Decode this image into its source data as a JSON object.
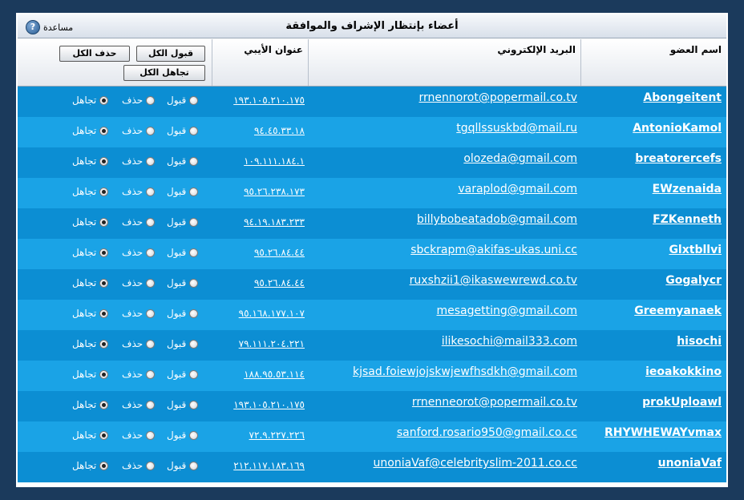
{
  "window": {
    "title": "أعضاء بإنتظار الإشراف والموافقة",
    "help_label": "مساعدة",
    "help_glyph": "?"
  },
  "columns": {
    "member": "اسم العضو",
    "email": "البريد الإلكتروني",
    "ip": "عنوان الأيبي"
  },
  "buttons": {
    "accept_all": "قبول الكل",
    "delete_all": "حذف الكل",
    "ignore_all": "تجاهل الكل"
  },
  "options": {
    "accept": "قبول",
    "delete": "حذف",
    "ignore": "تجاهل"
  },
  "rows": [
    {
      "member": "Abongeitent",
      "email": "rrnennorot@popermail.co.tv",
      "ip": "١٩٣.١٠٥.٢١٠.١٧٥",
      "selected": "ignore"
    },
    {
      "member": "AntonioKamol",
      "email": "tgqllssuskbd@mail.ru",
      "ip": "٩٤.٤٥.٣٣.١٨",
      "selected": "ignore"
    },
    {
      "member": "breatorercefs",
      "email": "olozeda@gmail.com",
      "ip": "١٠٩.١١١.١٨٤.١",
      "selected": "ignore"
    },
    {
      "member": "EWzenaida",
      "email": "varaplod@gmail.com",
      "ip": "٩٥.٢٦.٢٣٨.١٧٣",
      "selected": "ignore"
    },
    {
      "member": "FZKenneth",
      "email": "billybobeatadob@gmail.com",
      "ip": "٩٤.١٩.١٨٣.٢٣٣",
      "selected": "ignore"
    },
    {
      "member": "Glxtbllvi",
      "email": "sbckrapm@akifas-ukas.uni.cc",
      "ip": "٩٥.٢٦.٨٤.٤٤",
      "selected": "ignore"
    },
    {
      "member": "Gogalycr",
      "email": "ruxshzii1@ikaswewrewd.co.tv",
      "ip": "٩٥.٢٦.٨٤.٤٤",
      "selected": "ignore"
    },
    {
      "member": "Greemyanaek",
      "email": "mesagetting@gmail.com",
      "ip": "٩٥.١٦٨.١٧٧.١٠٧",
      "selected": "ignore"
    },
    {
      "member": "hisochi",
      "email": "ilikesochi@mail333.com",
      "ip": "٧٩.١١١.٢٠٤.٢٢١",
      "selected": "ignore"
    },
    {
      "member": "ieoakokkino",
      "email": "kjsad.foiewjojskwjewfhsdkh@gmail.com",
      "ip": "١٨٨.٩٥.٥٣.١١٤",
      "selected": "ignore"
    },
    {
      "member": "prokUploawl",
      "email": "rrnenneorot@popermail.co.tv",
      "ip": "١٩٣.١٠٥.٢١٠.١٧٥",
      "selected": "ignore"
    },
    {
      "member": "RHYWHEWAYvmax",
      "email": "sanford.rosario950@gmail.co.cc",
      "ip": "٧٢.٩.٢٢٧.٢٢٦",
      "selected": "ignore"
    },
    {
      "member": "unoniaVaf",
      "email": "unoniaVaf@celebrityslim-2011.co.cc",
      "ip": "٢١٢.١١٧.١٨٣.١٦٩",
      "selected": "ignore"
    }
  ]
}
